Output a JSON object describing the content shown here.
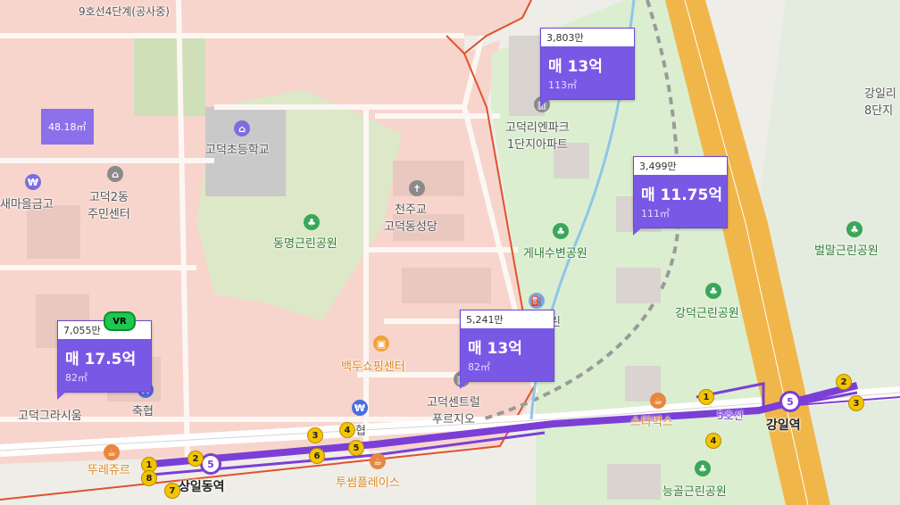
{
  "roads": {
    "top_road": "9호선4단계(공사중)",
    "line5": "5호선"
  },
  "places": {
    "school": "고덕초등학교",
    "saemaeul": "새마을금고",
    "community": "고덕2동\n주민센터",
    "church": "천주교\n고덕동성당",
    "park_dongmyeong": "동명근린공원",
    "shop_baekdu": "백두쇼핑센터",
    "gracium": "고덕그라시움",
    "nonghyup": "축협",
    "central_prugio": "고덕센트럴\n푸르지오",
    "park_genaesubyeon": "게내수변공원",
    "gangdeok_park": "강덕근린공원",
    "bulmal_park": "벌말근린공원",
    "starbucks": "스타벅스",
    "twosome": "투썸플레이스",
    "tous": "뚜레쥬르",
    "neunggol_park": "능골근린공원",
    "apt_enpark": "고덕리엔파크\n1단지아파트",
    "gangil_8": "강일리\n8단지",
    "hyeop": "협",
    "rin": "린"
  },
  "stations": {
    "gangil": "강일역",
    "sangil": "상일동역",
    "line_no": "5"
  },
  "exits": [
    "1",
    "2",
    "3",
    "4",
    "5",
    "6",
    "7",
    "8"
  ],
  "cards": [
    {
      "price_top": "3,803만",
      "main": "매 13억",
      "area": "113㎡"
    },
    {
      "price_top": "3,499만",
      "main": "매 11.75억",
      "area": "111㎡"
    },
    {
      "price_top": "5,241만",
      "main": "매 13억",
      "area": "82㎡"
    },
    {
      "price_top": "7,055만",
      "main": "매 17.5억",
      "area": "82㎡"
    }
  ],
  "small_tag": "48.18㎡",
  "vr_label": "VR",
  "colors": {
    "residential_zone": "#f7d5cc",
    "zone_border": "#e0512c",
    "park_green": "#dbeed0",
    "card_purple": "#7a58e6",
    "line5_purple": "#7b3fd6",
    "highway_orange": "#f1b64a",
    "exit_yellow": "#f4c400"
  }
}
